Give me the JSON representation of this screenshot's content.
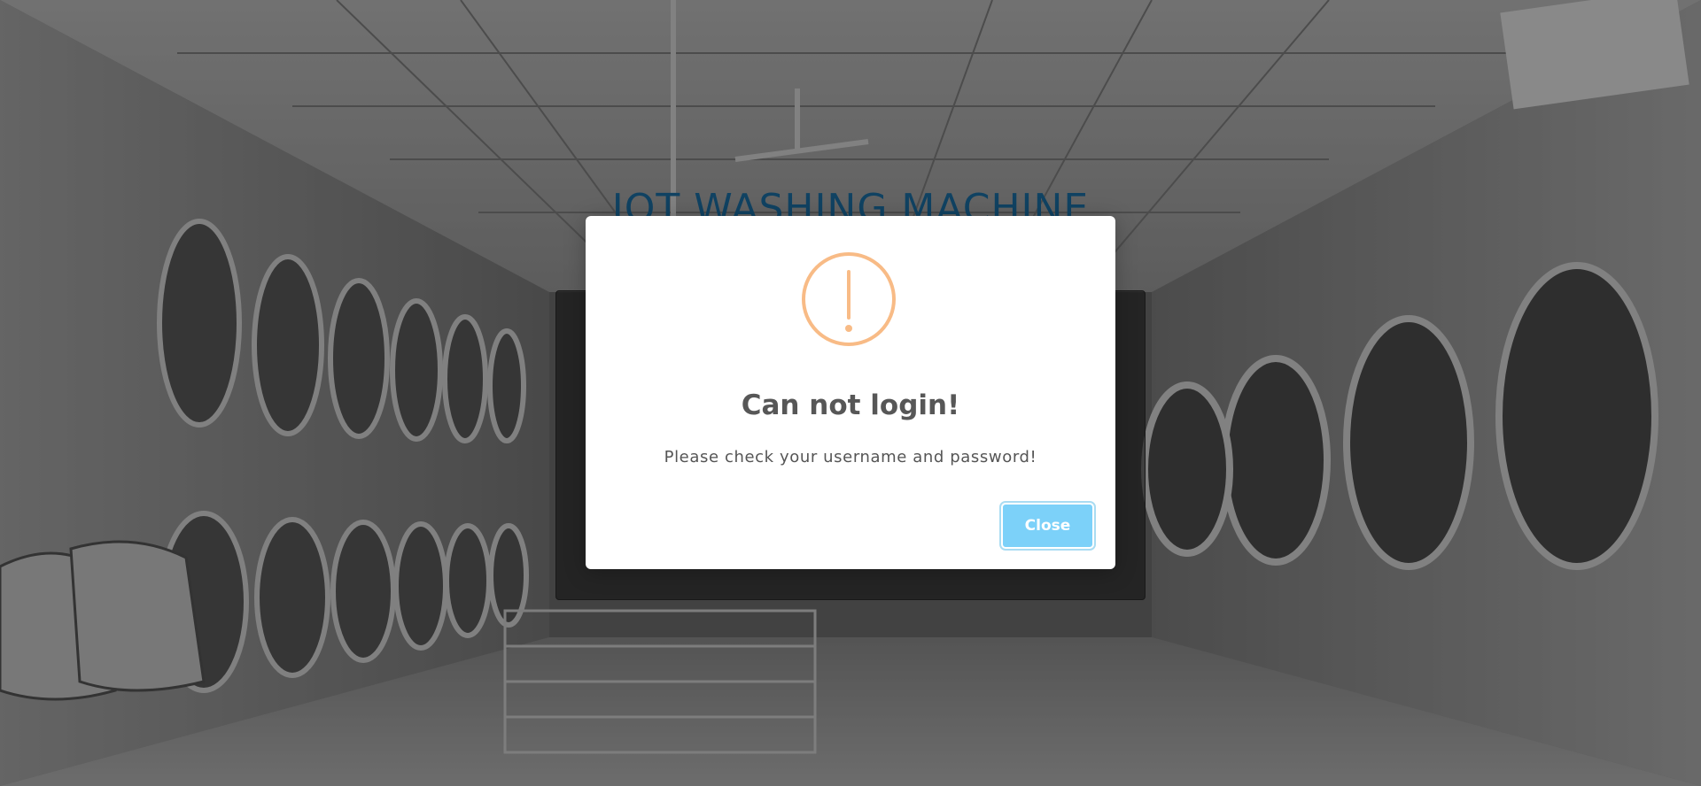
{
  "page": {
    "title": "IOT WASHING MACHINE"
  },
  "modal": {
    "title": "Can not login!",
    "text": "Please check your username and password!",
    "close_label": "Close",
    "icon": "warning-icon"
  },
  "colors": {
    "warning": "#f8bb86",
    "button": "#7cd1f9",
    "title_accent": "#1c6fa3"
  }
}
